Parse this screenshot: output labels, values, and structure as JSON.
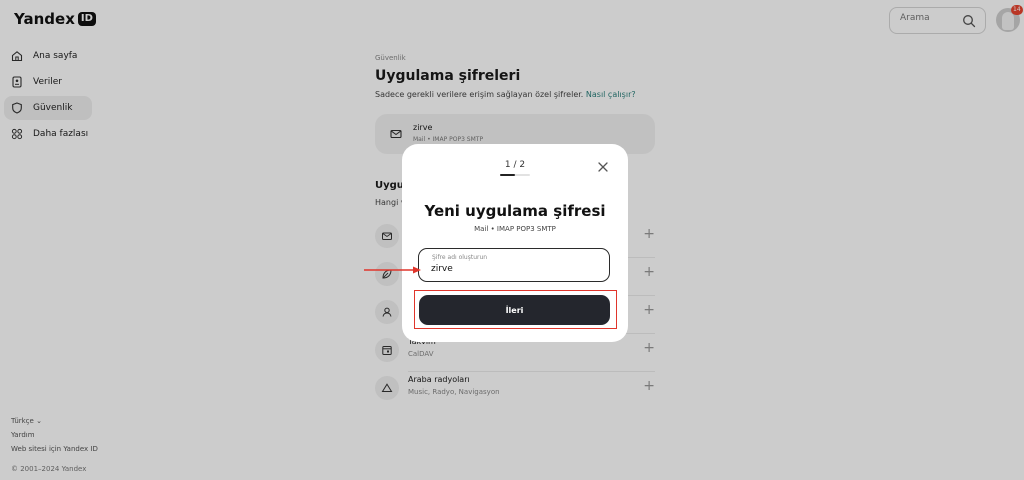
{
  "header": {
    "logo_text": "Yandex",
    "logo_badge": "ID",
    "search_placeholder": "Arama",
    "notification_count": "14"
  },
  "sidebar": {
    "items": [
      {
        "label": "Ana sayfa",
        "icon": "home-icon",
        "active": false
      },
      {
        "label": "Veriler",
        "icon": "id-card-icon",
        "active": false
      },
      {
        "label": "Güvenlik",
        "icon": "shield-icon",
        "active": true
      },
      {
        "label": "Daha fazlası",
        "icon": "grid-icon",
        "active": false
      }
    ],
    "footer": {
      "language": "Türkçe",
      "help": "Yardım",
      "website": "Web sitesi için Yandex ID",
      "copyright": "© 2001–2024 Yandex"
    }
  },
  "main": {
    "breadcrumb": "Güvenlik",
    "title": "Uygulama şifreleri",
    "subtitle": "Sadece gerekli verilere erişim sağlayan özel şifreler.",
    "subtitle_link": "Nasıl çalışır?",
    "existing_password": {
      "name": "zirve",
      "description": "Mail • IMAP POP3 SMTP"
    },
    "section_title_partial": "Uygu",
    "section_subtitle_partial": "Hangi v",
    "rows": [
      {
        "name": "",
        "description": "",
        "icon": "mail-icon"
      },
      {
        "name": "",
        "description": "",
        "icon": "leaf-icon"
      },
      {
        "name": "",
        "description": "",
        "icon": "contacts-icon"
      },
      {
        "name": "Takvim",
        "description": "CalDAV",
        "icon": "calendar-icon"
      },
      {
        "name": "Araba radyoları",
        "description": "Music, Radyo, Navigasyon",
        "icon": "car-radio-icon"
      }
    ]
  },
  "modal": {
    "step": "1 / 2",
    "progress_fraction": 0.5,
    "title": "Yeni uygulama şifresi",
    "subtitle": "Mail • IMAP POP3 SMTP",
    "field_label": "Şifre adı oluşturun",
    "field_value": "zirve",
    "next_button": "İleri"
  },
  "colors": {
    "accent_link": "#2a7f7b",
    "button_dark": "#24262d",
    "annotation_red": "#e0352b",
    "badge_red": "#e8442f"
  }
}
